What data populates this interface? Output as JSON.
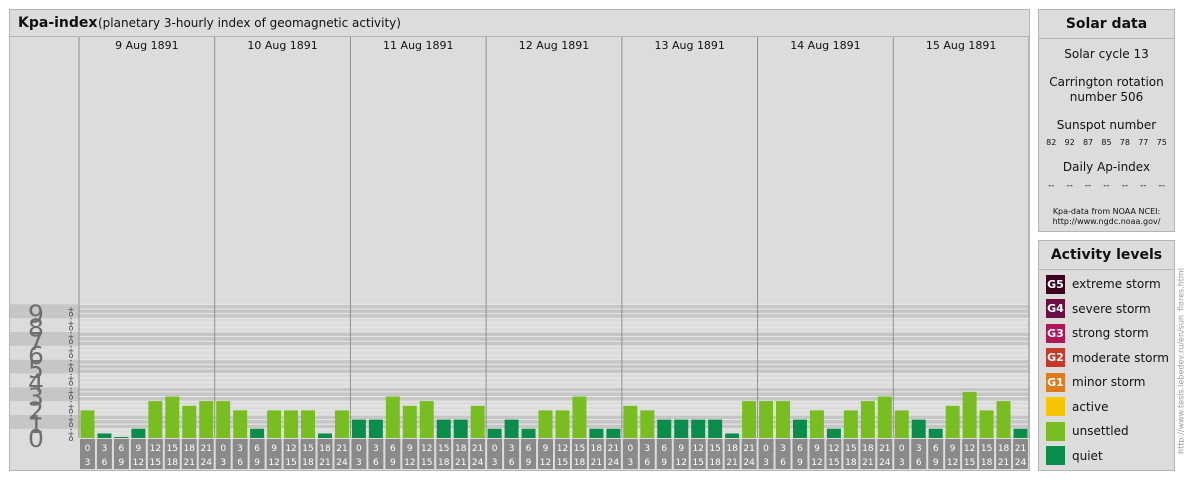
{
  "header": {
    "title": "Kpa-index",
    "subtitle": "(planetary 3-hourly index of geomagnetic activity)"
  },
  "chart_data": {
    "type": "bar",
    "days": [
      "9 Aug 1891",
      "10 Aug 1891",
      "11 Aug 1891",
      "12 Aug 1891",
      "13 Aug 1891",
      "14 Aug 1891",
      "15 Aug 1891"
    ],
    "hour_starts": [
      "0",
      "3",
      "6",
      "9",
      "12",
      "15",
      "18",
      "21"
    ],
    "hour_ends": [
      "3",
      "6",
      "9",
      "12",
      "15",
      "18",
      "21",
      "24"
    ],
    "y_ticks": [
      "0",
      "1",
      "2",
      "3",
      "4",
      "5",
      "6",
      "7",
      "8",
      "9"
    ],
    "subticks": [
      "o",
      "-",
      "+"
    ],
    "ylim": [
      0,
      9.67
    ],
    "values": [
      2.0,
      0.33,
      0.0,
      0.67,
      2.67,
      3.0,
      2.33,
      2.67,
      2.67,
      2.0,
      0.67,
      2.0,
      2.0,
      2.0,
      0.33,
      2.0,
      1.33,
      1.33,
      3.0,
      2.33,
      2.67,
      1.33,
      1.33,
      2.33,
      0.67,
      1.33,
      0.67,
      2.0,
      2.0,
      3.0,
      0.67,
      0.67,
      2.33,
      2.0,
      1.33,
      1.33,
      1.33,
      1.33,
      0.33,
      2.67,
      2.67,
      2.67,
      1.33,
      2.0,
      0.67,
      2.0,
      2.67,
      3.0,
      2.0,
      1.33,
      0.67,
      2.33,
      3.33,
      2.0,
      2.67,
      0.67
    ]
  },
  "colors": {
    "quiet": "#0a8c4b",
    "unsettled": "#78be21",
    "active": "#f7c600",
    "minor": "#e07b1c",
    "moderate": "#c8382a",
    "strong": "#b0165a",
    "severe": "#6b0e45",
    "extreme": "#3b001e"
  },
  "solar": {
    "title": "Solar data",
    "cycle": "Solar cycle 13",
    "carrington_1": "Carrington rotation",
    "carrington_2": "number 506",
    "sunspot_label": "Sunspot number",
    "sunspots": [
      "82",
      "92",
      "87",
      "85",
      "78",
      "77",
      "75"
    ],
    "ap_label": "Daily Ap-index",
    "ap_values": [
      "--",
      "--",
      "--",
      "--",
      "--",
      "--",
      "--"
    ],
    "credit_1": "Kpa-data from NOAA NCEI:",
    "credit_2": "http://www.ngdc.noaa.gov/"
  },
  "levels": {
    "title": "Activity levels",
    "items": [
      {
        "badge": "G5",
        "label": "extreme storm",
        "color": "#3b001e"
      },
      {
        "badge": "G4",
        "label": "severe storm",
        "color": "#6b0e45"
      },
      {
        "badge": "G3",
        "label": "strong storm",
        "color": "#b0165a"
      },
      {
        "badge": "G2",
        "label": "moderate storm",
        "color": "#c8382a"
      },
      {
        "badge": "G1",
        "label": "minor storm",
        "color": "#e07b1c"
      },
      {
        "badge": "",
        "label": "active",
        "color": "#f7c600"
      },
      {
        "badge": "",
        "label": "unsettled",
        "color": "#78be21"
      },
      {
        "badge": "",
        "label": "quiet",
        "color": "#0a8c4b"
      }
    ]
  },
  "vertical_credit": "http://www.tesis.lebedev.ru/en/sun_flares.html"
}
